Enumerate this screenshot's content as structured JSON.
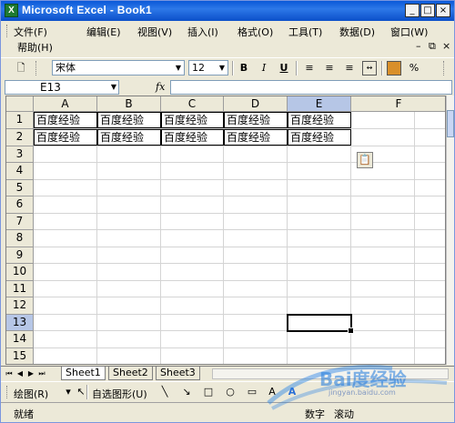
{
  "window": {
    "title": "Microsoft Excel - Book1",
    "icon_letter": "X",
    "minimize_icon": "minimize-icon",
    "maximize_icon": "maximize-icon",
    "close_icon": "close-icon"
  },
  "menu": {
    "items": [
      {
        "label": "文件(F)"
      },
      {
        "label": "编辑(E)"
      },
      {
        "label": "视图(V)"
      },
      {
        "label": "插入(I)"
      },
      {
        "label": "格式(O)"
      },
      {
        "label": "工具(T)"
      },
      {
        "label": "数据(D)"
      },
      {
        "label": "窗口(W)"
      }
    ],
    "help": "帮助(H)"
  },
  "toolbar": {
    "font_name": "宋体",
    "font_size": "12",
    "bold": "B",
    "italic": "I",
    "underline": "U",
    "percent": "%"
  },
  "formula_bar": {
    "name_box": "E13",
    "fx": "fx",
    "value": ""
  },
  "sheet": {
    "columns": [
      "A",
      "B",
      "C",
      "D",
      "E",
      "F"
    ],
    "rows": [
      "1",
      "2",
      "3",
      "4",
      "5",
      "6",
      "7",
      "8",
      "9",
      "10",
      "11",
      "12",
      "13",
      "14",
      "15"
    ],
    "selected_column": "E",
    "selected_row": "13",
    "cells": {
      "A1": "百度经验",
      "B1": "百度经验",
      "C1": "百度经验",
      "D1": "百度经验",
      "E1": "百度经验",
      "A2": "百度经验",
      "B2": "百度经验",
      "C2": "百度经验",
      "D2": "百度经验",
      "E2": "百度经验"
    }
  },
  "tabs": {
    "sheets": [
      {
        "label": "Sheet1",
        "active": true
      },
      {
        "label": "Sheet2",
        "active": false
      },
      {
        "label": "Sheet3",
        "active": false
      }
    ]
  },
  "drawing": {
    "draw_label": "绘图(R)",
    "autoshapes_label": "自选图形(U)"
  },
  "status": {
    "ready": "就绪",
    "num": "数字",
    "scroll": "滚动"
  },
  "watermark": {
    "text": "Bai度经验",
    "url": "jingyan.baidu.com"
  },
  "colors": {
    "title_bar": "#0a58d8",
    "chrome": "#ece9d8",
    "selected_header": "#b6c6e6"
  }
}
